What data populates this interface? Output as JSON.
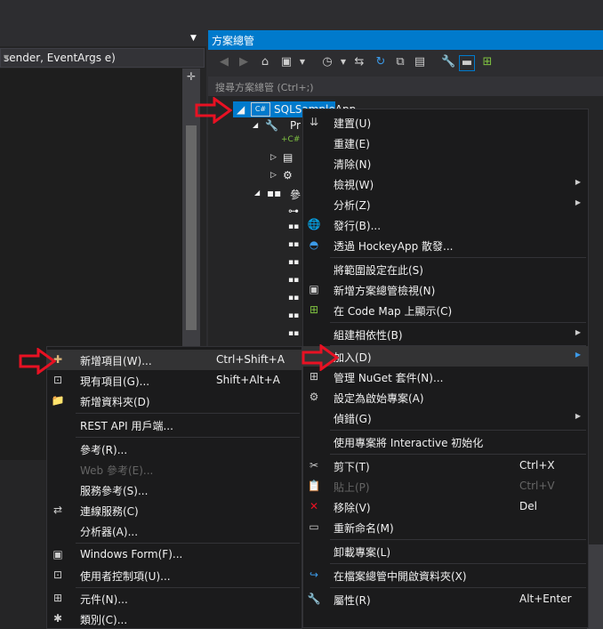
{
  "editor": {
    "signature": "sender, EventArgs e)"
  },
  "solution_explorer": {
    "title": "方案總管",
    "search_placeholder": "搜尋方案總管 (Ctrl+;)",
    "tree": {
      "project_name": "SQLSampleApp",
      "properties_label": "Pr",
      "references_label": "參"
    }
  },
  "context_menu": {
    "items": [
      {
        "label": "建置(U)"
      },
      {
        "label": "重建(E)"
      },
      {
        "label": "清除(N)"
      },
      {
        "label": "檢視(W)"
      },
      {
        "label": "分析(Z)"
      },
      {
        "label": "發行(B)..."
      },
      {
        "label": "透過 HockeyApp 散發..."
      },
      {
        "label": "將範圍設定在此(S)"
      },
      {
        "label": "新增方案總管檢視(N)"
      },
      {
        "label": "在 Code Map 上顯示(C)"
      },
      {
        "label": "組建相依性(B)"
      },
      {
        "label": "加入(D)"
      },
      {
        "label": "管理 NuGet 套件(N)..."
      },
      {
        "label": "設定為啟始專案(A)"
      },
      {
        "label": "偵錯(G)"
      },
      {
        "label": "使用專案將 Interactive 初始化"
      },
      {
        "label": "剪下(T)",
        "shortcut": "Ctrl+X"
      },
      {
        "label": "貼上(P)",
        "shortcut": "Ctrl+V"
      },
      {
        "label": "移除(V)",
        "shortcut": "Del"
      },
      {
        "label": "重新命名(M)"
      },
      {
        "label": "卸載專案(L)"
      },
      {
        "label": "在檔案總管中開啟資料夾(X)"
      },
      {
        "label": "屬性(R)",
        "shortcut": "Alt+Enter"
      }
    ]
  },
  "add_submenu": {
    "items": [
      {
        "label": "新增項目(W)...",
        "shortcut": "Ctrl+Shift+A"
      },
      {
        "label": "現有項目(G)...",
        "shortcut": "Shift+Alt+A"
      },
      {
        "label": "新增資料夾(D)"
      },
      {
        "label": "REST API 用戶端..."
      },
      {
        "label": "參考(R)..."
      },
      {
        "label": "Web 參考(E)..."
      },
      {
        "label": "服務參考(S)..."
      },
      {
        "label": "連線服務(C)"
      },
      {
        "label": "分析器(A)..."
      },
      {
        "label": "Windows Form(F)..."
      },
      {
        "label": "使用者控制項(U)..."
      },
      {
        "label": "元件(N)..."
      },
      {
        "label": "類別(C)..."
      }
    ]
  },
  "colors": {
    "accent": "#007acc",
    "arrow": "#e81123",
    "menu_bg": "#1b1b1c",
    "highlight": "#333334"
  }
}
